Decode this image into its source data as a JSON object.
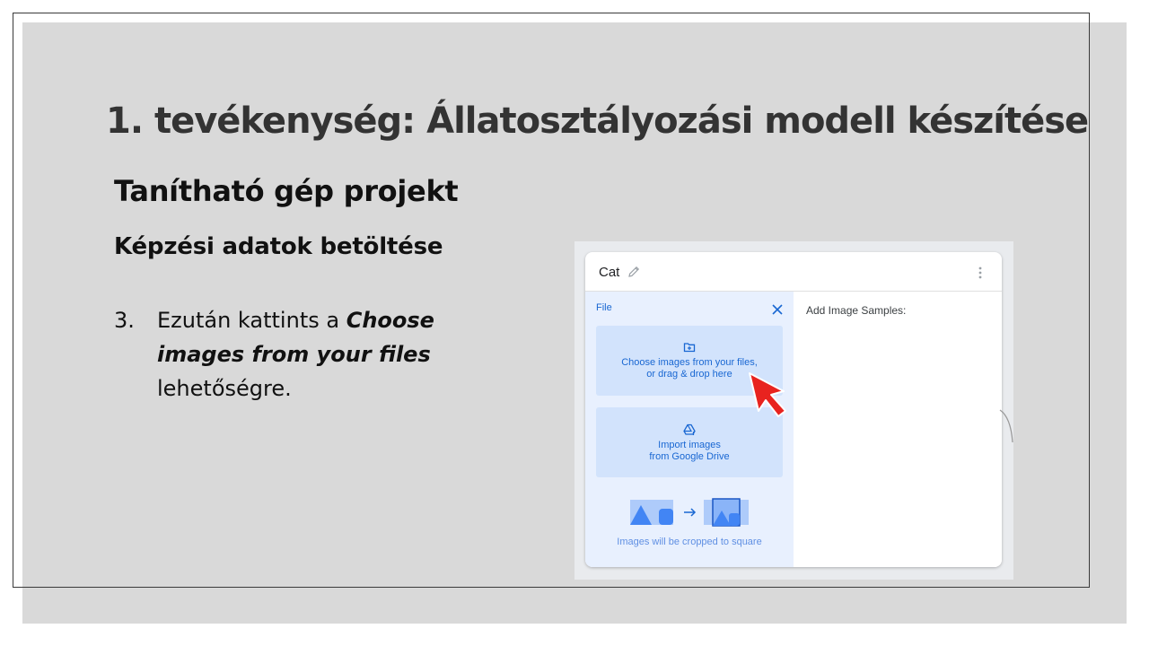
{
  "slide": {
    "title": "1. tevékenység: Állatosztályozási modell készítése",
    "subtitle": "Tanítható gép projekt",
    "section_heading": "Képzési adatok betöltése",
    "step": {
      "number": "3.",
      "text_before": "Ezután kattints a ",
      "text_bold_italic": "Choose images from your files",
      "text_after": "lehetőségre."
    }
  },
  "screenshot": {
    "class_card": {
      "class_name": "Cat",
      "icons": {
        "edit": "pencil-icon",
        "menu": "kebab-menu-icon",
        "close": "close-icon"
      },
      "file_label": "File",
      "choose_tile": {
        "icon": "folder-upload-icon",
        "line1": "Choose images from your files,",
        "line2": "or drag & drop here"
      },
      "drive_tile": {
        "icon": "google-drive-icon",
        "line1": "Import images",
        "line2": "from Google Drive"
      },
      "crop_caption": "Images will be cropped to square",
      "add_samples_label": "Add Image Samples:"
    },
    "colors": {
      "accent_blue": "#1967d2",
      "tile_blue": "#d2e3fc",
      "pane_blue": "#e8f0fe",
      "cursor_red": "#e8231f"
    }
  }
}
